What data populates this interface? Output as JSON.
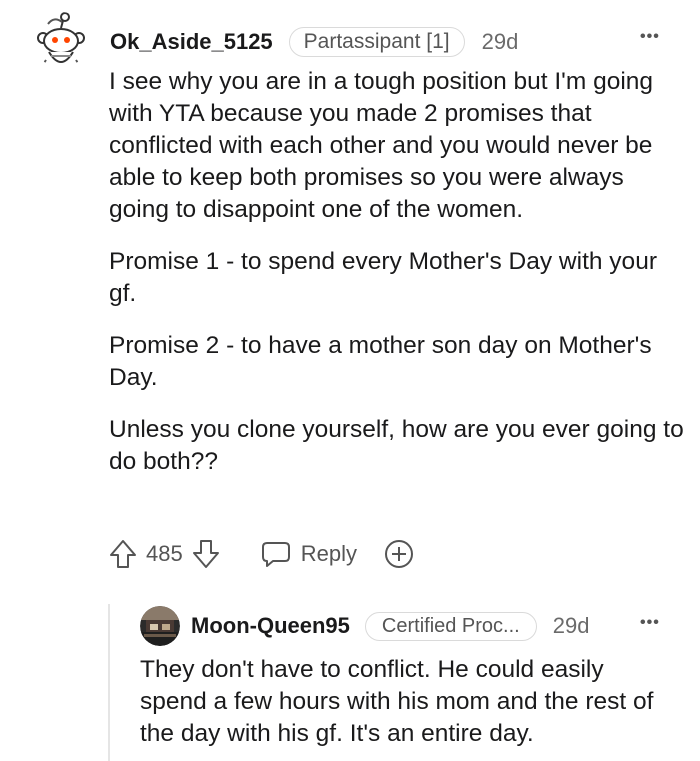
{
  "comments": [
    {
      "username": "Ok_Aside_5125",
      "flair": "Partassipant [1]",
      "time": "29d",
      "more": "•••",
      "paragraphs": [
        "I see why you are in a tough position but I'm going with YTA because you made 2 promises that conflicted with each other and you would never be able to keep both promises so you were always going to disappoint one of the women.",
        "Promise 1 - to spend every Mother's Day with your gf.",
        "Promise 2 - to have a mother son day on Mother's Day.",
        "Unless you clone yourself, how are you ever going to do both??"
      ],
      "score": "485",
      "reply_label": "Reply",
      "icons": {
        "avatar": "snoo-avatar-icon",
        "upvote": "upvote-arrow-icon",
        "downvote": "downvote-arrow-icon",
        "reply": "speech-bubble-icon",
        "award": "plus-award-icon"
      }
    },
    {
      "username": "Moon-Queen95",
      "flair": "Certified Proc...",
      "time": "29d",
      "more": "•••",
      "text": "They don't have to conflict. He could easily spend a few hours with his mom and the rest of the day with his gf. It's an entire day.",
      "icons": {
        "avatar": "user-avatar-icon"
      }
    }
  ],
  "colors": {
    "text": "#1a1a1b",
    "muted": "#6a6a6a",
    "flair_border": "#dadada",
    "thread_line": "#e5e5e5"
  }
}
